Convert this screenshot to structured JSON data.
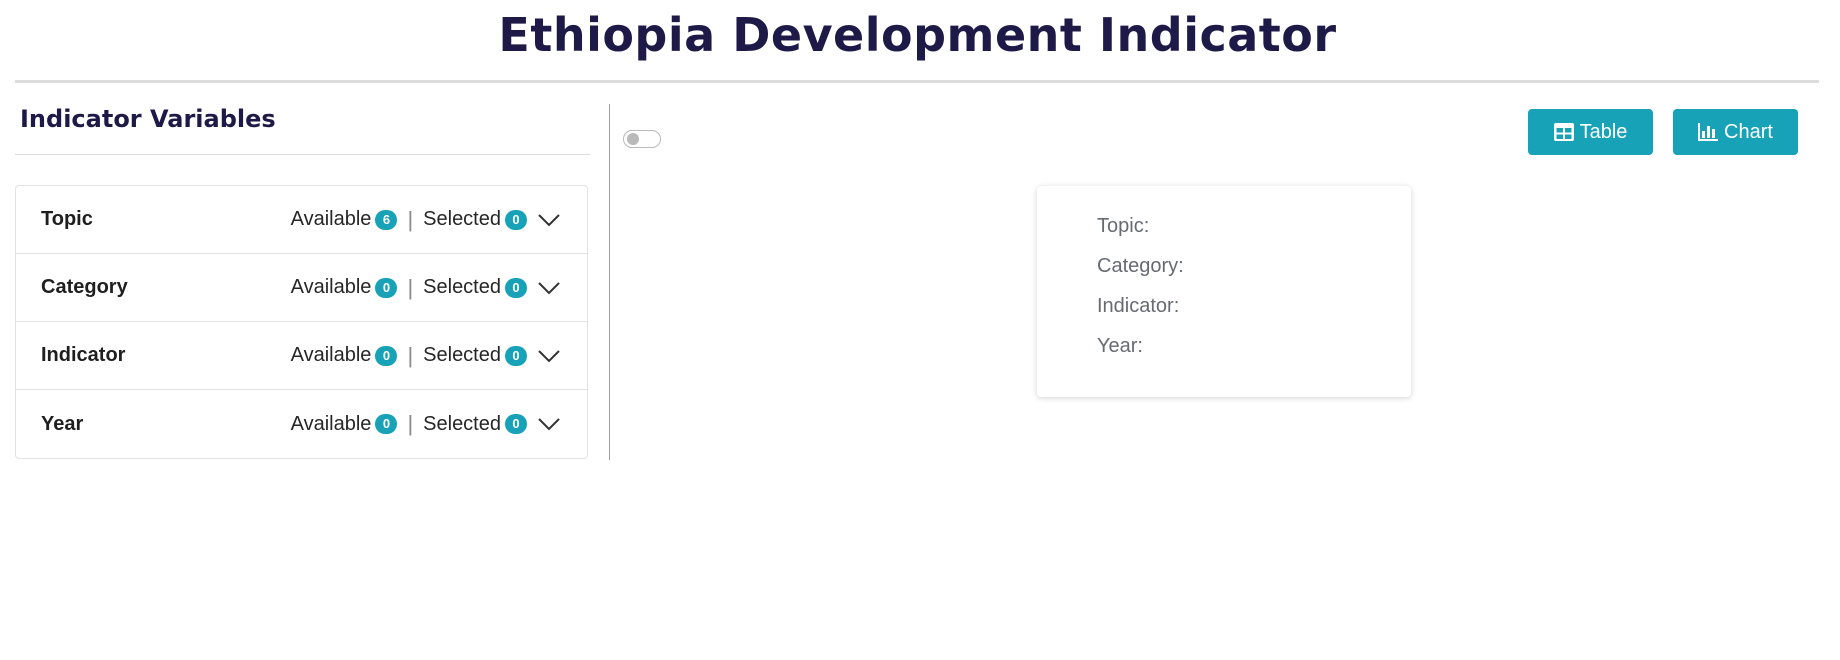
{
  "header": {
    "title": "Ethiopia Development Indicator"
  },
  "panel": {
    "heading": "Indicator Variables",
    "available_label": "Available",
    "selected_label": "Selected",
    "separator": "|",
    "rows": [
      {
        "label": "Topic",
        "available": "6",
        "selected": "0"
      },
      {
        "label": "Category",
        "available": "0",
        "selected": "0"
      },
      {
        "label": "Indicator",
        "available": "0",
        "selected": "0"
      },
      {
        "label": "Year",
        "available": "0",
        "selected": "0"
      }
    ]
  },
  "toolbar": {
    "toggle_on": false,
    "table_label": "Table",
    "chart_label": "Chart"
  },
  "summary": {
    "topic_label": "Topic:",
    "category_label": "Category:",
    "indicator_label": "Indicator:",
    "year_label": "Year:"
  },
  "colors": {
    "accent": "#17a2b8",
    "title": "#1e1a48"
  },
  "icons": {
    "table": "table-icon",
    "chart": "bar-chart-icon",
    "expand": "chevron-down-icon"
  }
}
